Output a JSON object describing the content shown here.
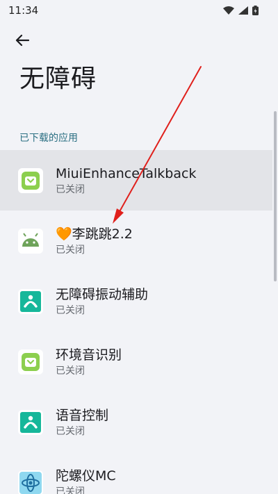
{
  "status_bar": {
    "time": "11:34"
  },
  "header": {
    "title": "无障碍"
  },
  "section": {
    "title": "已下载的应用"
  },
  "apps": [
    {
      "name": "MiuiEnhanceTalkback",
      "status": "已关闭",
      "icon": "green-download-icon"
    },
    {
      "name_prefix": "🧡",
      "name": "李跳跳2.2",
      "status": "已关闭",
      "icon": "android-robot-icon"
    },
    {
      "name": "无障碍振动辅助",
      "status": "已关闭",
      "icon": "teal-accessibility-icon"
    },
    {
      "name": "环境音识别",
      "status": "已关闭",
      "icon": "green-download-icon"
    },
    {
      "name": "语音控制",
      "status": "已关闭",
      "icon": "teal-accessibility-icon"
    },
    {
      "name": "陀螺仪MC",
      "status": "已关闭",
      "icon": "gyroscope-icon"
    }
  ],
  "colors": {
    "accent": "#2a6f82",
    "annotation_arrow": "#e0201c",
    "highlight_row": "#e3e4e8"
  }
}
